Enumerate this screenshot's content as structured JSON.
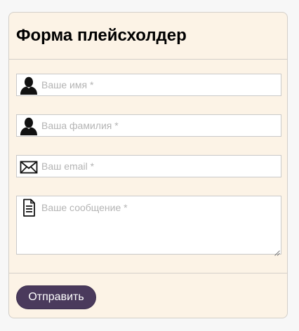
{
  "form": {
    "title": "Форма плейсхолдер",
    "fields": {
      "first_name": {
        "icon": "user-icon",
        "placeholder": "Ваше имя *",
        "value": ""
      },
      "last_name": {
        "icon": "user-icon",
        "placeholder": "Ваша фамилия *",
        "value": ""
      },
      "email": {
        "icon": "envelope-icon",
        "placeholder": "Ваш email *",
        "value": ""
      },
      "message": {
        "icon": "document-icon",
        "placeholder": "Ваше сообщение *",
        "value": ""
      }
    },
    "submit_label": "Отправить"
  },
  "colors": {
    "card_background": "#fcf3e6",
    "button_background": "#4a3a5c",
    "placeholder_text": "#b4b4b4",
    "border": "#c9c9c9"
  }
}
